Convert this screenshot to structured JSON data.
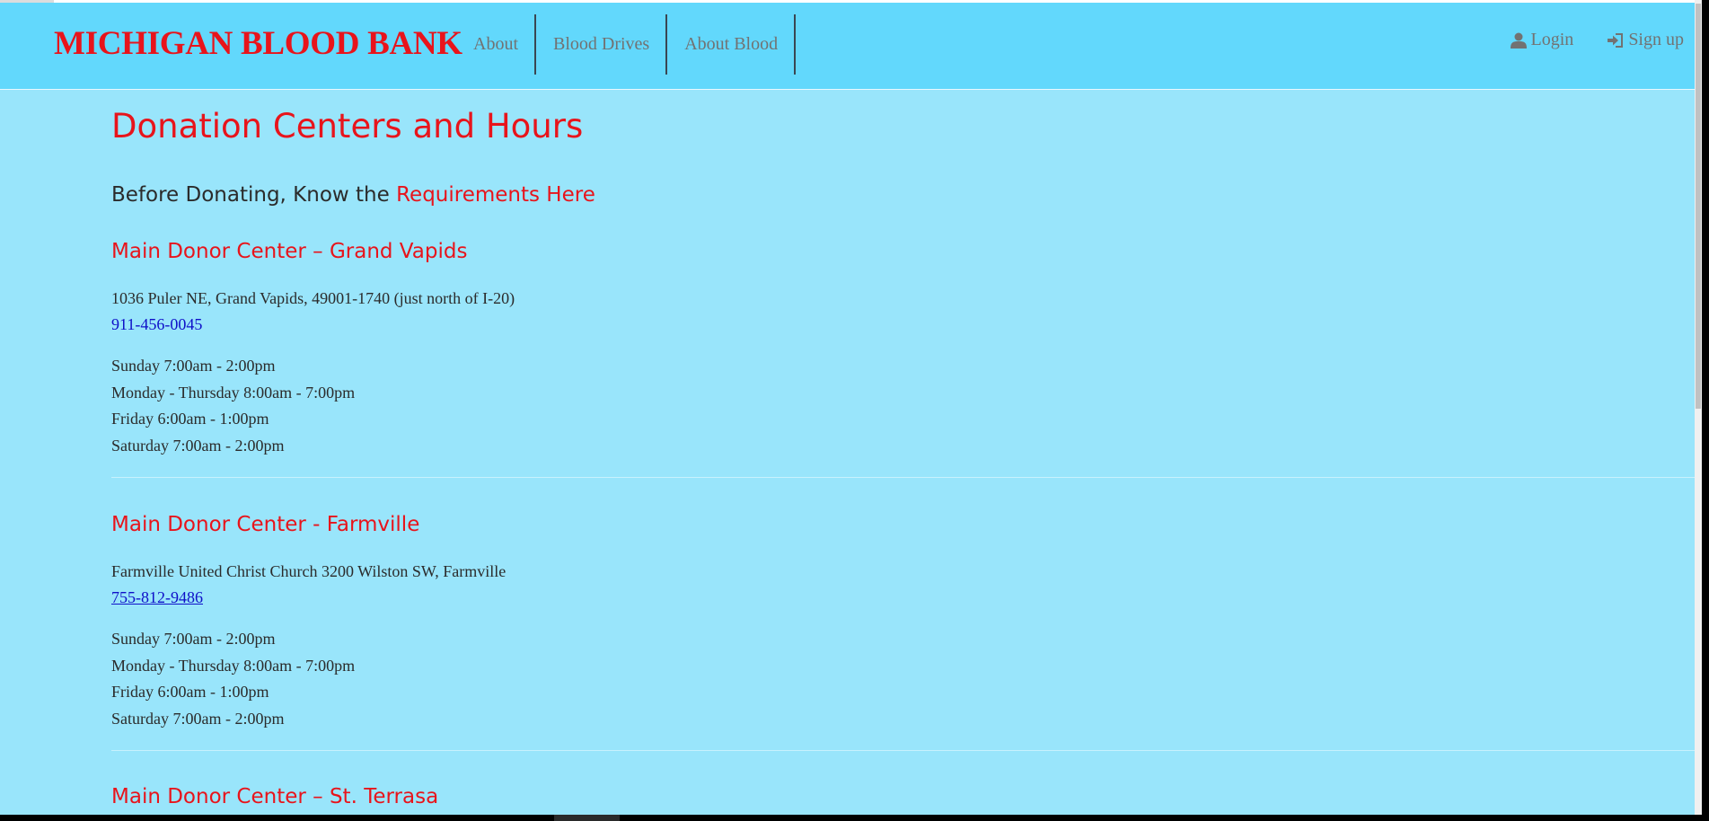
{
  "navbar": {
    "brand": "MICHIGAN BLOOD BANK",
    "links": [
      {
        "label": "About"
      },
      {
        "label": "Blood Drives"
      },
      {
        "label": "About Blood"
      }
    ],
    "login_label": "Login",
    "signup_label": "Sign up",
    "login_icon": "user-icon",
    "signup_icon": "sign-in-icon"
  },
  "page": {
    "title": "Donation Centers and Hours",
    "requirements_prefix": "Before Donating, Know the ",
    "requirements_link": "Requirements Here"
  },
  "centers": [
    {
      "name": "Main Donor Center – Grand Vapids",
      "address": "1036 Puler NE, Grand Vapids, 49001-1740 (just north of I-20)",
      "phone": "911-456-0045",
      "hours": [
        "Sunday 7:00am - 2:00pm",
        "Monday - Thursday 8:00am - 7:00pm",
        "Friday 6:00am - 1:00pm",
        "Saturday 7:00am - 2:00pm"
      ]
    },
    {
      "name": "Main Donor Center - Farmville",
      "address": "Farmville United Christ Church 3200 Wilston SW, Farmville",
      "phone": "755-812-9486",
      "hours": [
        "Sunday 7:00am - 2:00pm",
        "Monday - Thursday 8:00am - 7:00pm",
        "Friday 6:00am - 1:00pm",
        "Saturday 7:00am - 2:00pm"
      ]
    },
    {
      "name": "Main Donor Center – St. Terrasa"
    }
  ],
  "colors": {
    "page_bg": "#99e5fb",
    "navbar_bg": "#62d8fc",
    "accent_red": "#e8141b",
    "link_blue": "#0f10c8",
    "nav_text": "#727272"
  }
}
